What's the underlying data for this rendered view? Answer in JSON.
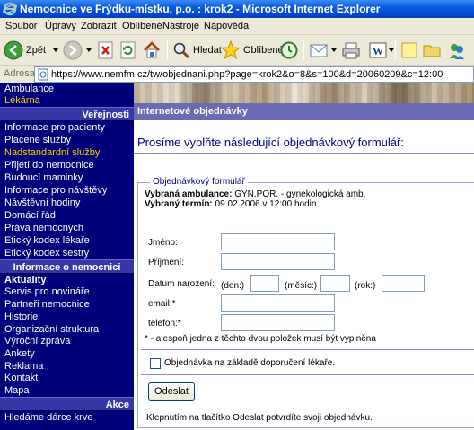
{
  "window": {
    "title": "Nemocnice ve Frýdku-místku, p.o. : krok2 - Microsoft Internet Explorer"
  },
  "menu": [
    "Soubor",
    "Úpravy",
    "Zobrazit",
    "Oblíbené",
    "Nástroje",
    "Nápověda"
  ],
  "toolbar": {
    "back_label": "Zpět",
    "search_label": "Hledat",
    "favorites_label": "Oblíbené"
  },
  "address": {
    "label": "Adresa",
    "url": "https://www.nemfm.cz/tw/objednani.php?page=krok2&o=8&s=100&d=20060209&c=12:00"
  },
  "sidebar": {
    "items_top": [
      "Ambulance",
      "Lékárna"
    ],
    "header1": "Veřejnosti",
    "items_public": [
      "Informace pro pacienty",
      "Placené služby",
      "Nadstandardní služby",
      "Přijetí do nemocnice",
      "Budoucí maminky",
      "Informace pro návštěvy",
      "Návštěvní hodiny",
      "Domácí řád",
      "Práva nemocných",
      "Etický kodex lékaře",
      "Etický kodex sestry"
    ],
    "header2": "Informace o nemocnici",
    "items_info": [
      "Aktuality",
      "Servis pro novináře",
      "Partneři nemocnice",
      "Historie",
      "Organizační struktura",
      "Výroční zpráva",
      "Ankety",
      "Reklama",
      "Kontakt",
      "Mapa"
    ],
    "header3": "Akce",
    "items_action": [
      "Hledáme dárce krve"
    ]
  },
  "main": {
    "section_title": "Internetové objednávky",
    "form_heading": "Prosíme vyplňte následující objednávkový formulář:",
    "legend": "Objednávkový formulář",
    "selected_amb_label": "Vybraná ambulance:",
    "selected_amb_value": "GYN.POR. - gynekologická amb.",
    "selected_term_label": "Vybraný termín:",
    "selected_term_value": "09.02.2006 v 12:00 hodin",
    "fields": {
      "jmeno": "Jméno:",
      "prijmeni": "Příjmení:",
      "datum": "Datum narození:",
      "den": "(den:)",
      "mesic": "(měsíc:)",
      "rok": "(rok:)",
      "email": "email:*",
      "telefon": "telefon:*"
    },
    "note": "* - alespoň jedna z těchto dvou položek musí být vyplněna",
    "checkbox_label": "Objednávka na základě doporučení lékaře.",
    "submit_label": "Odeslat",
    "bottom_text": "Klepnutím na tlačítko Odeslat potvrdíte svoji objednávku."
  }
}
